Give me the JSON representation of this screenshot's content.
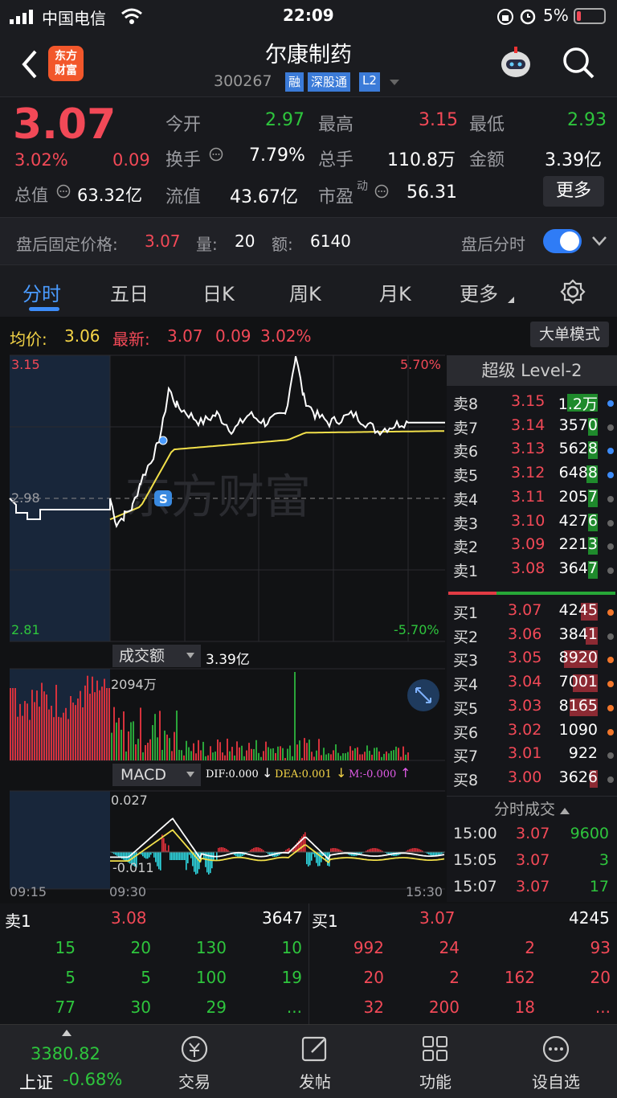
{
  "status": {
    "carrier": "中国电信",
    "time": "22:09",
    "battery": "5%"
  },
  "header": {
    "title": "尔康制药",
    "code": "300267",
    "tags": [
      "融",
      "深股通",
      "L2"
    ],
    "logo": "东方财富"
  },
  "quote": {
    "price": "3.07",
    "pct": "3.02%",
    "change": "0.09",
    "open_label": "今开",
    "open": "2.97",
    "high_label": "最高",
    "high": "3.15",
    "low_label": "最低",
    "low": "2.93",
    "turnover_label": "换手",
    "turnover": "7.79%",
    "vol_label": "总手",
    "vol": "110.8万",
    "amt_label": "金额",
    "amt": "3.39亿",
    "mcap_label": "总值",
    "mcap": "63.32亿",
    "float_label": "流值",
    "float": "43.67亿",
    "pe_label": "市盈",
    "pe_sup": "动",
    "pe": "56.31",
    "more": "更多"
  },
  "afterhours": {
    "price_label": "盘后固定价格:",
    "price": "3.07",
    "vol_label": "量:",
    "vol": "20",
    "amt_label": "额:",
    "amt": "6140",
    "toggle_label": "盘后分时"
  },
  "tabs": [
    "分时",
    "五日",
    "日K",
    "周K",
    "月K",
    "更多"
  ],
  "chart_header": {
    "avg_label": "均价:",
    "avg": "3.06",
    "last_label": "最新:",
    "last": "3.07",
    "chg": "0.09",
    "pct": "3.02%",
    "mode_button": "大单模式"
  },
  "chart_labels": {
    "top": "3.15",
    "mid": "2.98",
    "bottom": "2.81",
    "top_pct": "5.70%",
    "bottom_pct": "-5.70%",
    "vol_selector": "成交额",
    "vol_total": "3.39亿",
    "vol_max": "2094万",
    "macd_selector": "MACD",
    "dif": "DIF:0.000",
    "dea": "DEA:0.001",
    "m": "M:-0.000",
    "macd_top": "0.027",
    "macd_bottom": "-0.011",
    "time_start": "09:15",
    "time_open": "09:30",
    "time_end": "15:30",
    "watermark": "东方财富",
    "marker": "S"
  },
  "l2": {
    "title": "超级 Level-2",
    "asks": [
      {
        "l": "卖8",
        "p": "3.15",
        "v": "1.2万"
      },
      {
        "l": "卖7",
        "p": "3.14",
        "v": "3570"
      },
      {
        "l": "卖6",
        "p": "3.13",
        "v": "5628"
      },
      {
        "l": "卖5",
        "p": "3.12",
        "v": "6488"
      },
      {
        "l": "卖4",
        "p": "3.11",
        "v": "2057"
      },
      {
        "l": "卖3",
        "p": "3.10",
        "v": "4276"
      },
      {
        "l": "卖2",
        "p": "3.09",
        "v": "2213"
      },
      {
        "l": "卖1",
        "p": "3.08",
        "v": "3647"
      }
    ],
    "bids": [
      {
        "l": "买1",
        "p": "3.07",
        "v": "4245"
      },
      {
        "l": "买2",
        "p": "3.06",
        "v": "3841"
      },
      {
        "l": "买3",
        "p": "3.05",
        "v": "8920"
      },
      {
        "l": "买4",
        "p": "3.04",
        "v": "7001"
      },
      {
        "l": "买5",
        "p": "3.03",
        "v": "8165"
      },
      {
        "l": "买6",
        "p": "3.02",
        "v": "1090"
      },
      {
        "l": "买7",
        "p": "3.01",
        "v": "922"
      },
      {
        "l": "买8",
        "p": "3.00",
        "v": "3626"
      }
    ],
    "trades_title": "分时成交",
    "trades": [
      {
        "t": "15:00",
        "p": "3.07",
        "v": "9600"
      },
      {
        "t": "15:05",
        "p": "3.07",
        "v": "3"
      },
      {
        "t": "15:07",
        "p": "3.07",
        "v": "17"
      }
    ]
  },
  "queue": {
    "sell_label": "卖1",
    "sell_price": "3.08",
    "sell_vol": "3647",
    "buy_label": "买1",
    "buy_price": "3.07",
    "buy_vol": "4245",
    "sell_rows": [
      [
        "15",
        "20",
        "130",
        "10"
      ],
      [
        "5",
        "5",
        "100",
        "19"
      ],
      [
        "77",
        "30",
        "29",
        "..."
      ]
    ],
    "buy_rows": [
      [
        "992",
        "24",
        "2",
        "93"
      ],
      [
        "20",
        "2",
        "162",
        "20"
      ],
      [
        "32",
        "200",
        "18",
        "..."
      ]
    ]
  },
  "footer": {
    "index_value": "3380.82",
    "index_name": "上证",
    "index_pct": "-0.68%",
    "items": [
      "交易",
      "发帖",
      "功能",
      "设自选"
    ]
  }
}
